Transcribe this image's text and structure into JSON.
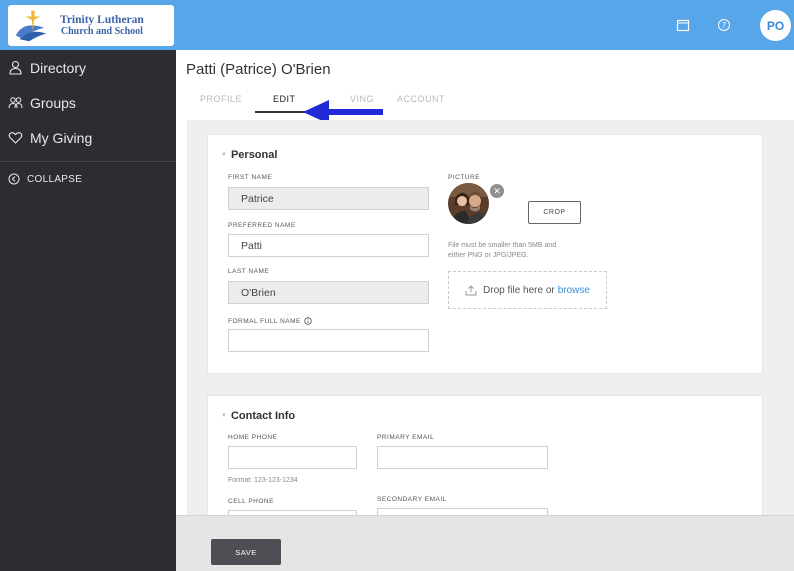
{
  "brand": {
    "line1": "Trinity Lutheran",
    "line2": "Church and School"
  },
  "topbar": {
    "avatar_initials": "PO",
    "icons": [
      "calendar-icon",
      "help-icon"
    ],
    "color": "#58a6ea"
  },
  "sidebar": {
    "items": [
      {
        "label": "Directory",
        "icon": "person-icon"
      },
      {
        "label": "Groups",
        "icon": "people-icon"
      },
      {
        "label": "My Giving",
        "icon": "heart-icon"
      }
    ],
    "collapse_label": "COLLAPSE"
  },
  "page": {
    "title": "Patti (Patrice) O'Brien",
    "tabs": [
      {
        "label": "PROFILE",
        "active": false
      },
      {
        "label": "EDIT",
        "active": true
      },
      {
        "label": "VING",
        "active": false
      },
      {
        "label": "ACCOUNT",
        "active": false
      }
    ]
  },
  "personal": {
    "title": "Personal",
    "first_name_label": "FIRST NAME",
    "first_name_value": "Patrice",
    "preferred_name_label": "PREFERRED NAME",
    "preferred_name_value": "Patti",
    "last_name_label": "LAST NAME",
    "last_name_value": "O'Brien",
    "formal_full_name_label": "FORMAL FULL NAME",
    "formal_full_name_value": "",
    "picture_label": "PICTURE",
    "crop_label": "CROP",
    "file_hint_line1": "File must be smaller than 5MB and",
    "file_hint_line2": "either PNG or JPG/JPEG.",
    "drop_text": "Drop file here or",
    "browse_text": "browse"
  },
  "contact": {
    "title": "Contact Info",
    "home_phone_label": "HOME PHONE",
    "home_phone_value": "",
    "format_hint": "Format: 123-123-1234",
    "primary_email_label": "PRIMARY EMAIL",
    "primary_email_value": "",
    "cell_phone_label": "CELL PHONE",
    "secondary_email_label": "SECONDARY EMAIL"
  },
  "footer": {
    "save_label": "SAVE"
  }
}
